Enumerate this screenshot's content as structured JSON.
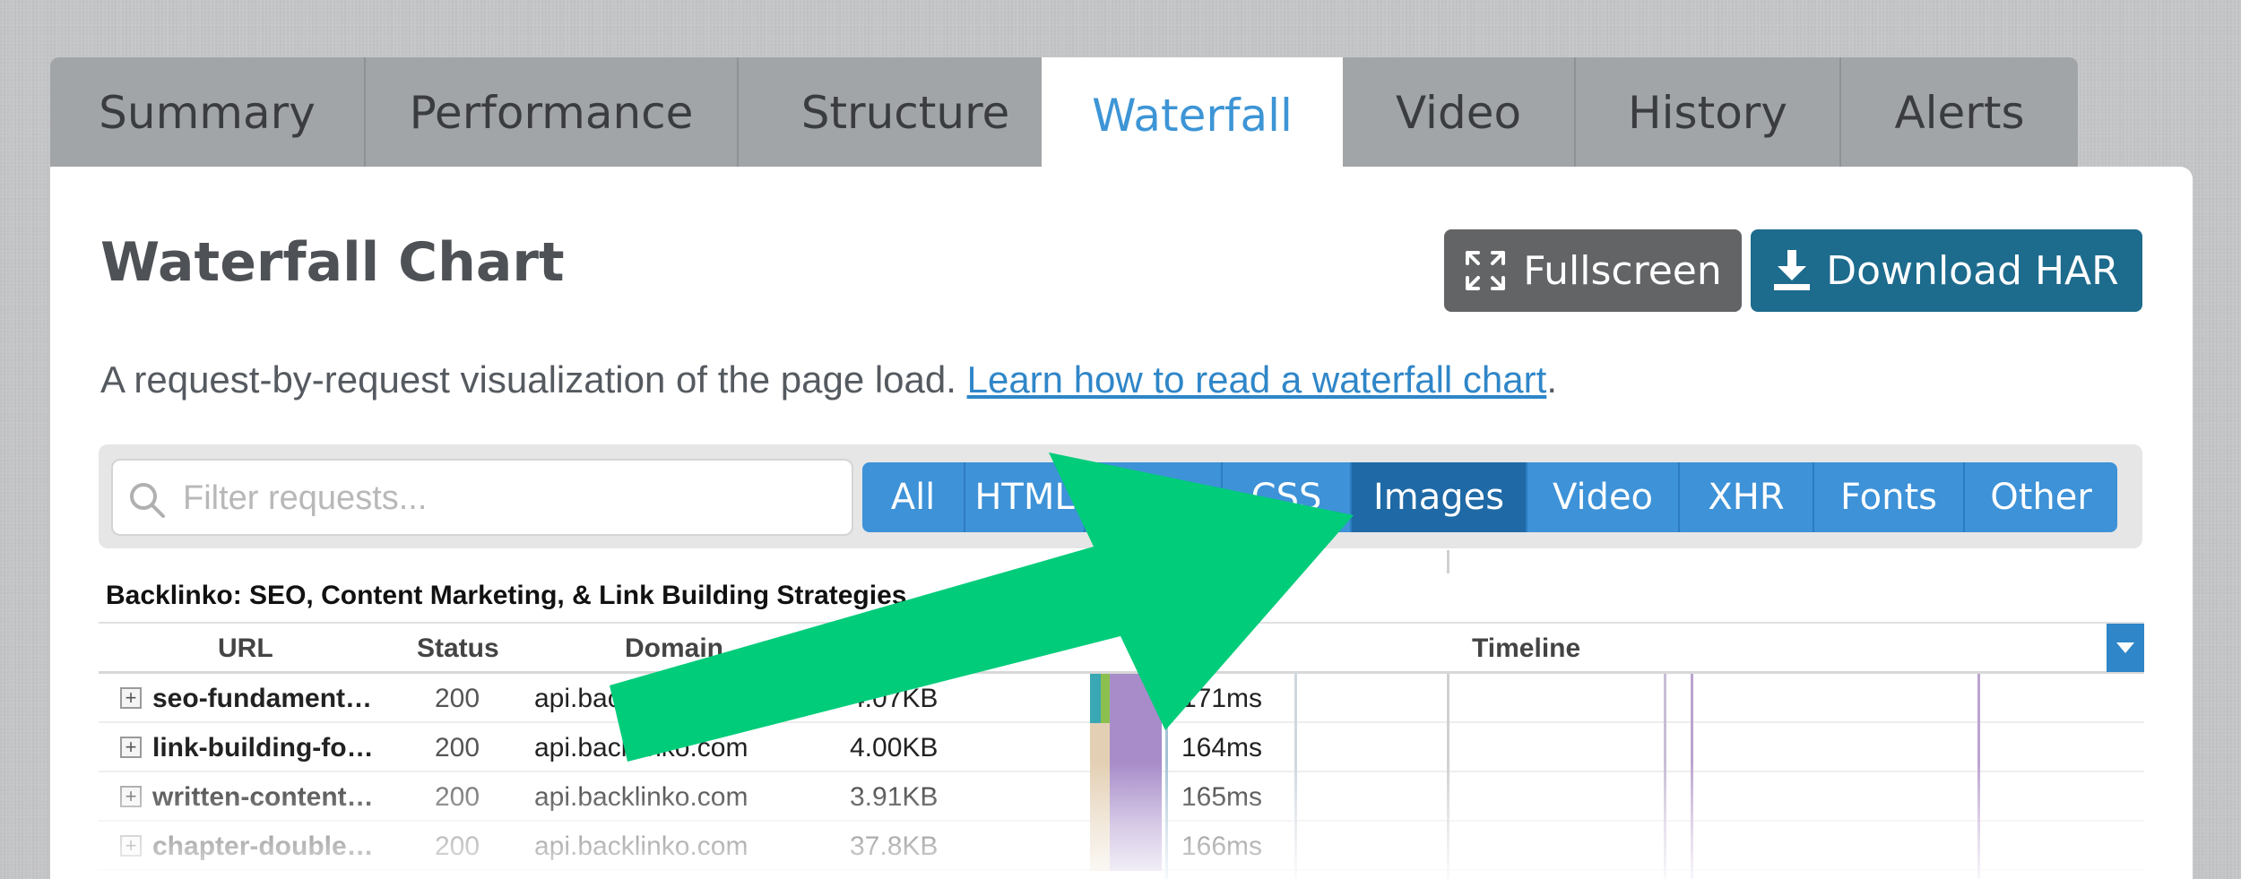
{
  "tabs": [
    {
      "label": "Summary"
    },
    {
      "label": "Performance"
    },
    {
      "label": "Structure"
    },
    {
      "label": "Waterfall"
    },
    {
      "label": "Video"
    },
    {
      "label": "History"
    },
    {
      "label": "Alerts"
    }
  ],
  "active_tab": "Waterfall",
  "page": {
    "title": "Waterfall Chart",
    "fullscreen_label": "Fullscreen",
    "download_label": "Download HAR",
    "subtitle": "A request-by-request visualization of the page load. ",
    "learn_link": "Learn how to read a waterfall chart",
    "subtitle_end": "."
  },
  "search": {
    "placeholder": "Filter requests..."
  },
  "filters": [
    {
      "label": "All"
    },
    {
      "label": "HTML"
    },
    {
      "label": "JS"
    },
    {
      "label": "CSS"
    },
    {
      "label": "Images"
    },
    {
      "label": "Video"
    },
    {
      "label": "XHR"
    },
    {
      "label": "Fonts"
    },
    {
      "label": "Other"
    }
  ],
  "active_filter": "Images",
  "table": {
    "title": "Backlinko: SEO, Content Marketing, & Link Building Strategies",
    "columns": {
      "url": "URL",
      "status": "Status",
      "domain": "Domain",
      "timeline": "Timeline"
    },
    "rows": [
      {
        "url": "seo-fundament…",
        "status": "200",
        "domain": "api.backlinko.com",
        "size": "4.07KB",
        "time": "171ms"
      },
      {
        "url": "link-building-fo…",
        "status": "200",
        "domain": "api.backlinko.com",
        "size": "4.00KB",
        "time": "164ms"
      },
      {
        "url": "written-content…",
        "status": "200",
        "domain": "api.backlinko.com",
        "size": "3.91KB",
        "time": "165ms"
      },
      {
        "url": "chapter-double…",
        "status": "200",
        "domain": "api.backlinko.com",
        "size": "37.8KB",
        "time": "166ms"
      }
    ]
  },
  "colors": {
    "accent_blue": "#3d92d8",
    "active_filter": "#1f6aa6",
    "download_button": "#1d6b8d",
    "fullscreen_button": "#636466",
    "arrow_green": "#00cc7a"
  },
  "icons": {
    "fullscreen": "expand-arrows-icon",
    "download": "download-icon",
    "search": "magnifier-icon",
    "expand_row": "plus-square-icon",
    "column_menu": "caret-down-icon"
  }
}
